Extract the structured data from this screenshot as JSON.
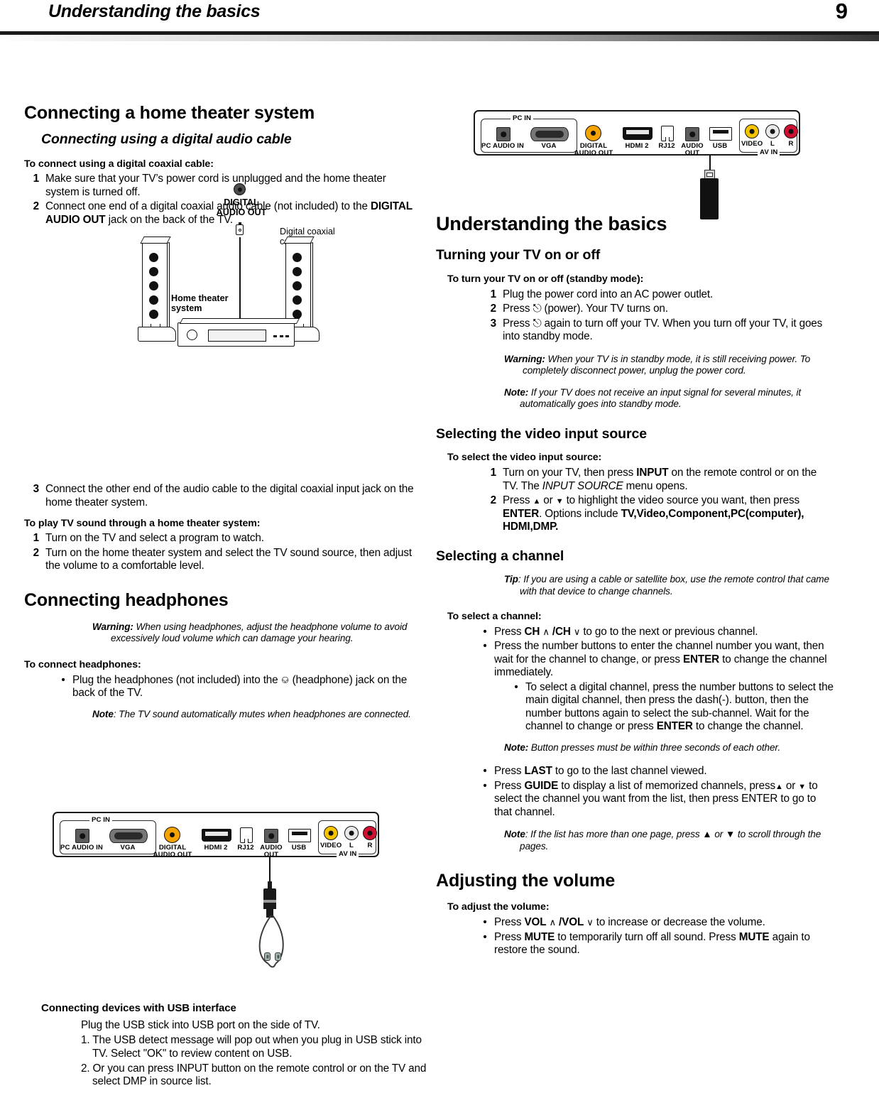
{
  "header": {
    "title": "Understanding the basics",
    "page_number": "9"
  },
  "left_column": {
    "heading_home_theater": "Connecting a home theater system",
    "subheading_digital_cable": "Connecting using a digital audio cable",
    "lead_coaxial": "To connect using a digital coaxial cable:",
    "steps_coaxial": [
      {
        "num": "1",
        "text": "Make sure that your TV’s power cord is unplugged and the home theater system is turned off."
      },
      {
        "num": "2",
        "text_before": "Connect one end of a digital coaxial audio cable (not included) to the ",
        "bold": "DIGITAL AUDIO OUT",
        "text_after": " jack on the back of the TV."
      }
    ],
    "diagram_home_theater": {
      "label_digital_audio_out": "DIGITAL\nAUDIO OUT",
      "label_coaxial_cable": "Digital coaxial cable",
      "label_home_theater_system": "Home theater\nsystem"
    },
    "step3": {
      "num": "3",
      "text": "Connect the other end of the audio cable to the digital coaxial input jack on the home theater system."
    },
    "lead_play_sound": "To play TV sound through a home theater system:",
    "steps_play_sound": [
      {
        "num": "1",
        "text": "Turn on the TV and select a program to watch."
      },
      {
        "num": "2",
        "text": "Turn on the home theater system and select the TV sound source, then adjust the volume to a comfortable level."
      }
    ],
    "heading_headphones": "Connecting headphones",
    "warning_headphones_label": "Warning:",
    "warning_headphones_text": " When using headphones, adjust the headphone volume to avoid excessively loud volume which can damage your hearing.",
    "lead_connect_headphones": "To connect headphones:",
    "bullet_headphones_before": "Plug the headphones (not included) into the ",
    "bullet_headphones_icon": "headphone-icon",
    "bullet_headphones_after": " (headphone) jack on the back of the TV.",
    "note_headphones_label": "Note",
    "note_headphones_text": ": The TV sound automatically mutes when headphones are connected.",
    "heading_usb": "Connecting devices with USB interface",
    "usb_intro": "Plug the USB stick into USB port on the side of TV.",
    "usb_steps": [
      "1. The USB detect message will pop out when you plug in USB stick into TV. Select \"OK\" to review content on USB.",
      "2. Or you can press INPUT button on the remote control or on the TV and select DMP in source list."
    ]
  },
  "tv_panel": {
    "group_pc_in": "PC IN",
    "group_av_in": "AV IN",
    "ports": {
      "pc_audio_in": "PC AUDIO IN",
      "vga": "VGA",
      "digital_audio_out": "DIGITAL\nAUDIO OUT",
      "hdmi2": "HDMI 2",
      "rj12": "RJ12",
      "audio_out": "AUDIO\nOUT",
      "usb": "USB",
      "video": "VIDEO",
      "left": "L",
      "right": "R"
    },
    "colors": {
      "digital_audio_out": "#f5a300",
      "video": "#f4c400",
      "left": "#e9e9e9",
      "right": "#cf1030"
    }
  },
  "right_column": {
    "heading_understanding": "Understanding the basics",
    "heading_turning_on": "Turning your TV on or off",
    "lead_turn_on": "To turn your TV on or off (standby mode):",
    "steps_turn_on": [
      {
        "num": "1",
        "text": "Plug the power cord into an AC power outlet."
      },
      {
        "num": "2",
        "text_before": "Press ",
        "icon": "power-icon",
        "text_after": " (power). Your TV turns on."
      },
      {
        "num": "3",
        "text_before": "Press ",
        "icon": "power-icon",
        "text_after": " again to turn off your TV. When you turn off your TV, it goes into standby mode."
      }
    ],
    "warning_standby_label": "Warning:",
    "warning_standby_text": " When your TV is in standby mode, it is still receiving power. To completely disconnect power, unplug the power cord.",
    "note_standby_label": "Note:",
    "note_standby_text": " If your TV does not receive an input signal for several minutes, it automatically goes into standby mode.",
    "heading_video_input": "Selecting the video input source",
    "lead_video_input": "To select the video input source:",
    "steps_video_input": [
      {
        "num": "1",
        "t1": "Turn on your TV, then press ",
        "b1": "INPUT",
        "t2": " on the remote control or on the TV. The ",
        "i1": "INPUT SOURCE",
        "t3": " menu opens."
      },
      {
        "num": "2",
        "t1": "Press ",
        "up": "▲",
        "t2": " or ",
        "down": "▼",
        "t3": " to highlight the video source you want, then press ",
        "b1": "ENTER",
        "t4": ". Options include ",
        "b2": "TV,Video,Component,PC(computer), HDMI,DMP."
      }
    ],
    "heading_selecting_channel": "Selecting a channel",
    "tip_label": "Tip",
    "tip_text": ": If you are using a cable or satellite box, use the remote control that came with that device to change channels.",
    "lead_select_channel": "To select a channel:",
    "bullets_channel": [
      {
        "t1": "Press ",
        "b1": "CH",
        "up": "∧",
        "b2": "/CH",
        "down": "∨",
        "t2": " to go to the next or previous channel."
      },
      {
        "t1": "Press the number buttons to enter the channel number you want, then wait for the channel to change, or press ",
        "b1": "ENTER",
        "t2": " to change the channel immediately."
      }
    ],
    "sub_bullet_digital": {
      "t1": "To select a digital channel, press the number buttons to select the main digital channel, then press the dash(-). button, then the number buttons again to select the sub-channel. Wait for the channel to change or press ",
      "b1": "ENTER",
      "t2": " to change the channel."
    },
    "note_button_presses_label": "Note:",
    "note_button_presses_text": " Button presses must be within three seconds of each other.",
    "bullets_channel2": [
      {
        "t1": "Press ",
        "b1": "LAST",
        "t2": "  to go to the last channel viewed."
      },
      {
        "t1": "Press ",
        "b1": "GUIDE",
        "t2": " to display a list of memorized channels, press",
        "up": "▲",
        "t3": " or ",
        "down": "▼",
        "t4": " to select the channel you want from the list, then press ENTER to go to that channel."
      }
    ],
    "note_pages_label": "Note",
    "note_pages_text": ": If the list has more than one page, press ▲ or ▼ to scroll through the pages.",
    "heading_adjust_volume": "Adjusting the volume",
    "lead_adjust_volume": "To adjust the volume:",
    "bullets_volume": [
      {
        "t1": "Press ",
        "b1": "VOL",
        "up": "∧",
        "b2": "/VOL",
        "down": "∨",
        "t2": " to increase or decrease the volume."
      },
      {
        "t1": "Press ",
        "b1": "MUTE",
        "t2": " to temporarily turn off all sound. Press ",
        "b2": "MUTE",
        "t3": " again to restore the sound."
      }
    ]
  }
}
